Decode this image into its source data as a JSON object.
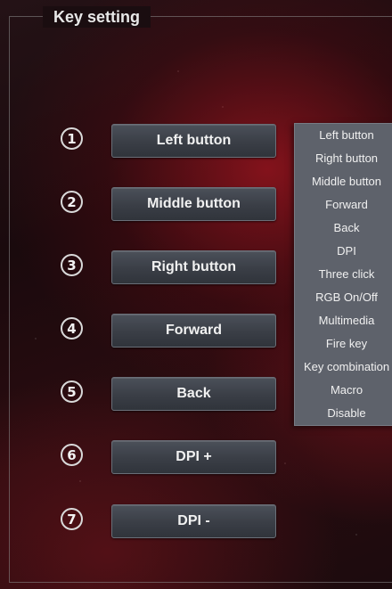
{
  "panel": {
    "title": "Key setting"
  },
  "buttons": [
    {
      "num": "1",
      "label": "Left button"
    },
    {
      "num": "2",
      "label": "Middle button"
    },
    {
      "num": "3",
      "label": "Right button"
    },
    {
      "num": "4",
      "label": "Forward"
    },
    {
      "num": "5",
      "label": "Back"
    },
    {
      "num": "6",
      "label": "DPI +"
    },
    {
      "num": "7",
      "label": "DPI -"
    }
  ],
  "menu": {
    "items": [
      "Left button",
      "Right button",
      "Middle button",
      "Forward",
      "Back",
      "DPI",
      "Three click",
      "RGB On/Off",
      "Multimedia",
      "Fire key",
      "Key combination",
      "Macro",
      "Disable"
    ]
  },
  "colors": {
    "button_face": "#3f434b",
    "menu_bg": "#5e626b",
    "text": "#f1f1f1"
  }
}
